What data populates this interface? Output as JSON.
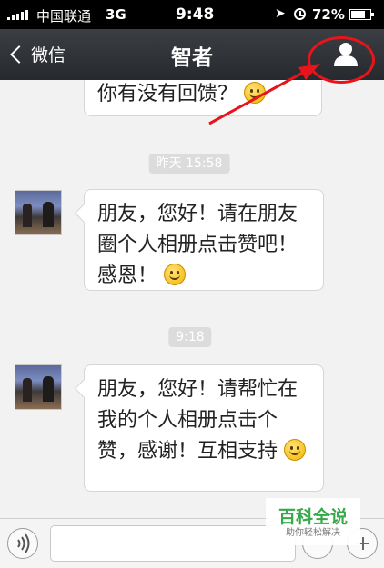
{
  "status_bar": {
    "carrier": "中国联通",
    "network": "3G",
    "time": "9:48",
    "battery": "72%"
  },
  "nav": {
    "back_label": "微信",
    "title": "智者"
  },
  "messages": [
    {
      "text": "你有没有回馈？"
    },
    {
      "timestamp": "昨天 15:58",
      "text": "朋友，您好！请在朋友圈个人相册点击赞吧！感恩！"
    },
    {
      "timestamp": "9:18",
      "text": "朋友，您好！请帮忙在我的个人相册点击个赞，感谢！互相支持"
    }
  ],
  "watermark": {
    "title": "百科全说",
    "subtitle": "助你轻松解决"
  },
  "colors": {
    "annotation": "#e8141b",
    "nav_bg": "#2f3236",
    "chat_bg": "#f2f2f2"
  }
}
